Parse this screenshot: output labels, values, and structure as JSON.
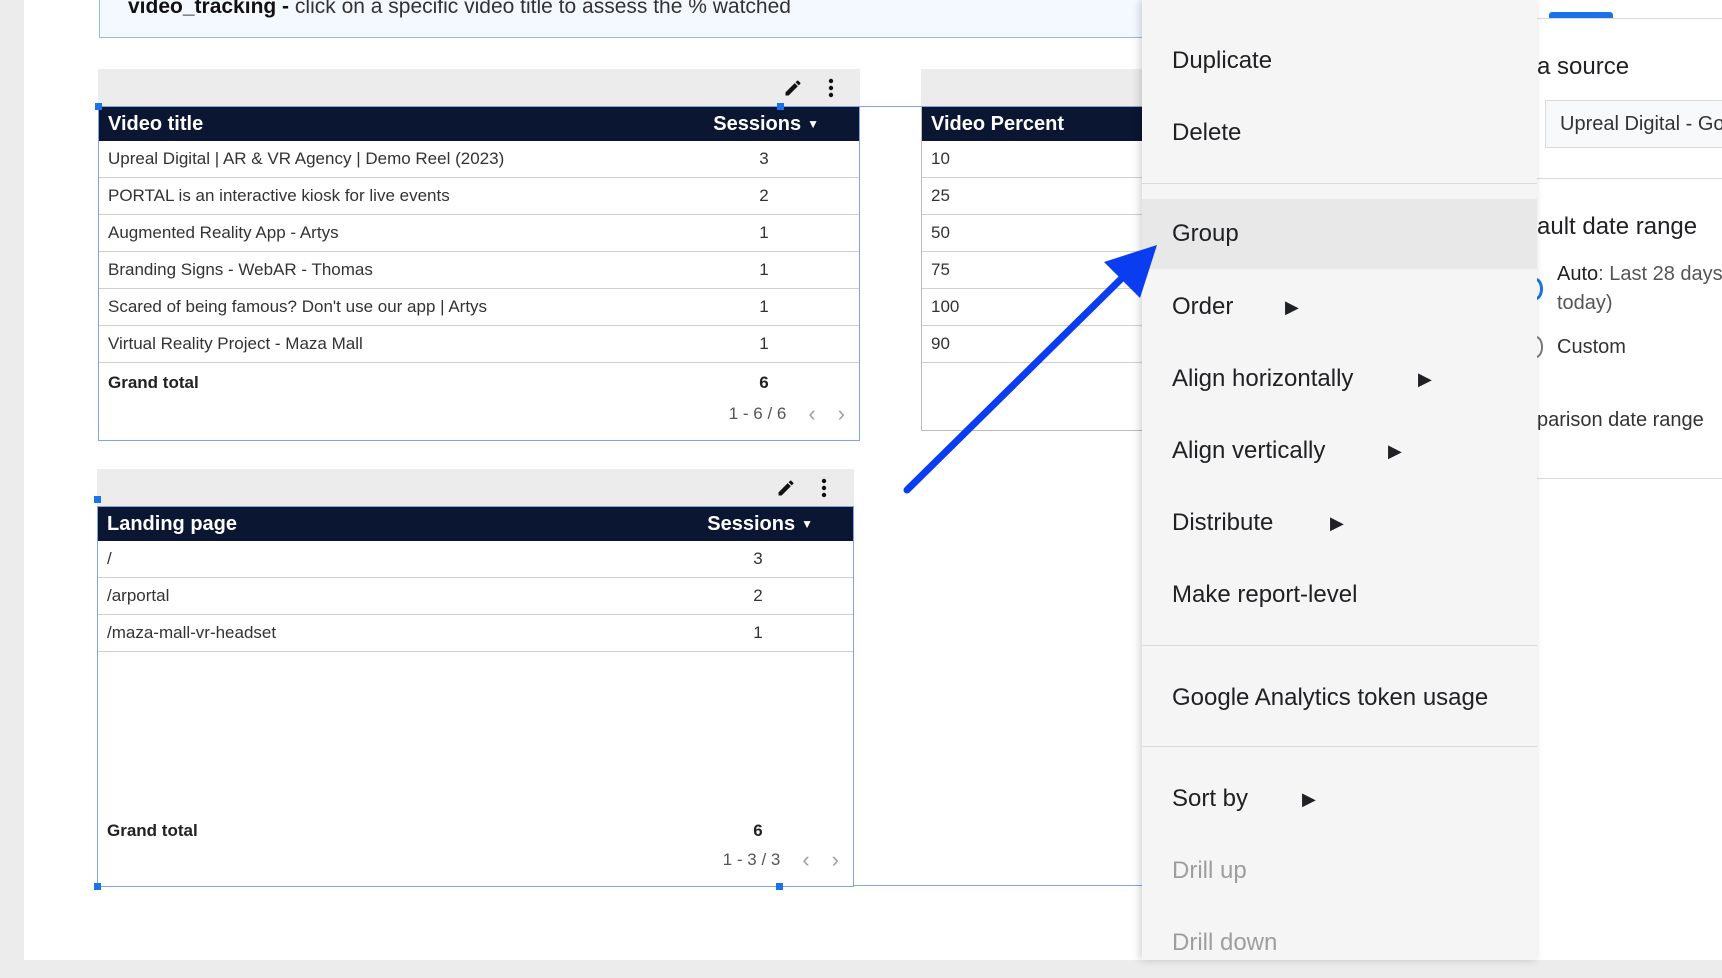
{
  "banner": {
    "bold": "video_tracking -",
    "text": " click on a specific video title to assess the % watched"
  },
  "video_table": {
    "col1": "Video title",
    "col2": "Sessions",
    "rows": [
      {
        "title": "Upreal Digital | AR & VR Agency | Demo Reel (2023)",
        "sessions": "3"
      },
      {
        "title": "PORTAL is an interactive kiosk for live events",
        "sessions": "2"
      },
      {
        "title": "Augmented Reality App - Artys",
        "sessions": "1"
      },
      {
        "title": "Branding Signs - WebAR - Thomas",
        "sessions": "1"
      },
      {
        "title": "Scared of being famous? Don't use our app | Artys",
        "sessions": "1"
      },
      {
        "title": "Virtual Reality Project - Maza Mall",
        "sessions": "1"
      }
    ],
    "grand_total_label": "Grand total",
    "grand_total": "6",
    "pager": "1 - 6 / 6"
  },
  "percent_table": {
    "col1": "Video Percent",
    "rows": [
      "10",
      "25",
      "50",
      "75",
      "100",
      "90"
    ]
  },
  "landing_table": {
    "col1": "Landing page",
    "col2": "Sessions",
    "rows": [
      {
        "page": "/",
        "sessions": "3"
      },
      {
        "page": "/arportal",
        "sessions": "2"
      },
      {
        "page": "/maza-mall-vr-headset",
        "sessions": "1"
      }
    ],
    "grand_total_label": "Grand total",
    "grand_total": "6",
    "pager": "1 - 3 / 3"
  },
  "context_menu": {
    "items": [
      {
        "label": "Duplicate"
      },
      {
        "label": "Delete"
      },
      {
        "label": "Group",
        "highlighted": true
      },
      {
        "label": "Order",
        "submenu": true
      },
      {
        "label": "Align horizontally",
        "submenu": true
      },
      {
        "label": "Align vertically",
        "submenu": true
      },
      {
        "label": "Distribute",
        "submenu": true
      },
      {
        "label": "Make report-level"
      },
      {
        "label": "Google Analytics token usage"
      },
      {
        "label": "Sort by",
        "submenu": true
      },
      {
        "label": "Drill up",
        "disabled": true
      },
      {
        "label": "Drill down",
        "disabled": true
      }
    ]
  },
  "right_panel": {
    "data_source_heading": "a source",
    "data_source_value": "Upreal Digital - Go",
    "date_range_heading": "ault date range",
    "auto_label": "Auto",
    "auto_value": ": Last 28 days",
    "auto_value_2": "today)",
    "custom_label": "Custom",
    "comparison_label": "parison date range"
  },
  "colors": {
    "table_header": "#0b1633",
    "accent": "#1a73e8",
    "annotation_arrow": "#0a3cf0"
  },
  "icons": [
    "pencil-icon",
    "more-vert-icon",
    "chevron-left-icon",
    "chevron-right-icon",
    "sort-caret-icon",
    "submenu-arrow-icon",
    "annotation-arrow"
  ]
}
